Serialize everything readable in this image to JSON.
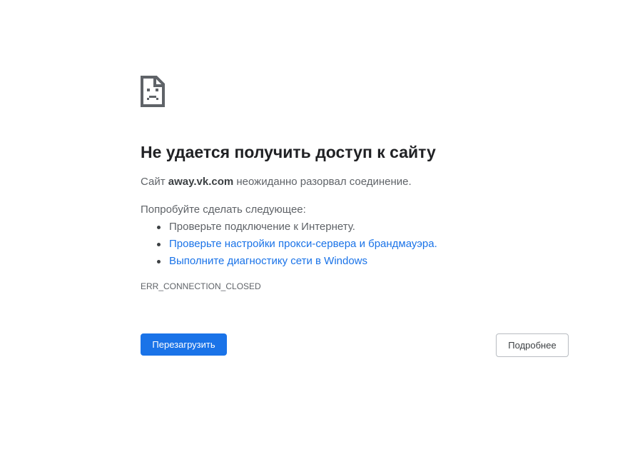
{
  "error_page": {
    "icon": "sad-page-icon",
    "title": "Не удается получить доступ к сайту",
    "description": {
      "prefix": "Сайт ",
      "host": "away.vk.com",
      "suffix": " неожиданно разорвал соединение."
    },
    "try_heading": "Попробуйте сделать следующее:",
    "suggestions": [
      "Проверьте подключение к Интернету.",
      "Проверьте настройки прокси-сервера и брандмауэра.",
      "Выполните диагностику сети в Windows"
    ],
    "error_code": "ERR_CONNECTION_CLOSED"
  },
  "buttons": {
    "reload_label": "Перезагрузить",
    "details_label": "Подробнее"
  },
  "colors": {
    "primary_button": "#1a73e8",
    "link": "#1a73e8",
    "title_text": "#202124",
    "body_text": "#5f6368"
  }
}
